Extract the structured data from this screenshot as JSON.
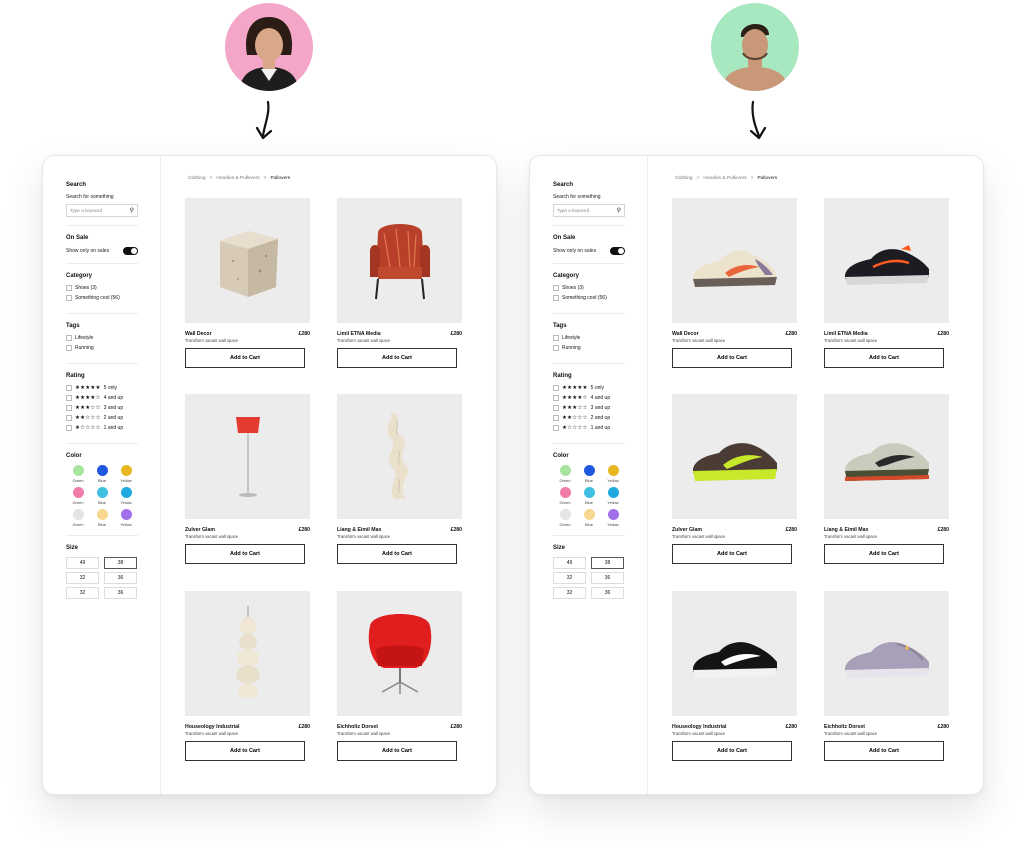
{
  "sidebar": {
    "search_title": "Search",
    "search_label": "Search for something",
    "search_placeholder": "Type a keyword",
    "sale_title": "On Sale",
    "sale_label": "Show only on sales",
    "category_title": "Category",
    "categories": [
      "Shoes (3)",
      "Something cool (56)"
    ],
    "tags_title": "Tags",
    "tags": [
      "Lifestyle",
      "Running"
    ],
    "rating_title": "Rating",
    "ratings": [
      {
        "stars": "★★★★★",
        "label": "5 only"
      },
      {
        "stars": "★★★★☆",
        "label": "4 and up"
      },
      {
        "stars": "★★★☆☆",
        "label": "3 and up"
      },
      {
        "stars": "★★☆☆☆",
        "label": "2 and up"
      },
      {
        "stars": "★☆☆☆☆",
        "label": "1 and up"
      }
    ],
    "color_title": "Color",
    "colors": [
      {
        "name": "Green",
        "hex": "#a8e3a0"
      },
      {
        "name": "Blue",
        "hex": "#2058e0"
      },
      {
        "name": "Yellow",
        "hex": "#e8b820"
      },
      {
        "name": "Green",
        "hex": "#f07aa8"
      },
      {
        "name": "Blue",
        "hex": "#40c0e0"
      },
      {
        "name": "Yellow",
        "hex": "#20a8e0"
      },
      {
        "name": "Green",
        "hex": "#e4e4e4"
      },
      {
        "name": "Blue",
        "hex": "#f8d890"
      },
      {
        "name": "Yellow",
        "hex": "#a070e8"
      }
    ],
    "size_title": "Size",
    "sizes": [
      "49",
      "38",
      "32",
      "36",
      "32",
      "36"
    ]
  },
  "breadcrumb": {
    "items": [
      "Clothing",
      "Hoodies & Pullovers",
      "Pullovers"
    ],
    "separator": ">"
  },
  "products": [
    {
      "name": "Wall Decor",
      "sub": "Transform vacant wall space",
      "price": "£280",
      "cart": "Add to Cart"
    },
    {
      "name": "Limil ETNA Media",
      "sub": "Transform vacant wall space",
      "price": "£280",
      "cart": "Add to Cart"
    },
    {
      "name": "Zulver Glam",
      "sub": "Transform vacant wall space",
      "price": "£280",
      "cart": "Add to Cart"
    },
    {
      "name": "Liang & Eimil Max",
      "sub": "Transform vacant wall space",
      "price": "£280",
      "cart": "Add to Cart"
    },
    {
      "name": "Houseology Industrial",
      "sub": "Transform vacant wall space",
      "price": "£280",
      "cart": "Add to Cart"
    },
    {
      "name": "Eichholtz Dorset",
      "sub": "Transform vacant wall space",
      "price": "£280",
      "cart": "Add to Cart"
    }
  ],
  "avatars": {
    "left_bg": "#f4a6c8",
    "right_bg": "#a8e8c0"
  }
}
